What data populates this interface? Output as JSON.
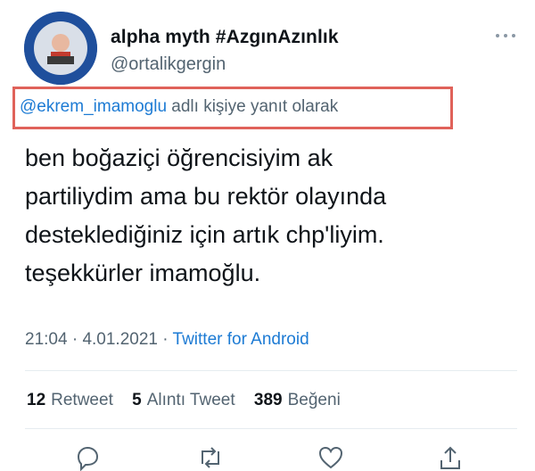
{
  "tweet": {
    "display_name": "alpha myth #AzgınAzınlık",
    "handle": "@ortalikgergin",
    "reply_mention": "@ekrem_imamoglu",
    "reply_suffix": " adlı kişiye yanıt olarak",
    "text_lines": [
      "ben boğaziçi öğrencisiyim ak",
      "partiliydim ama bu rektör olayında",
      "desteklediğiniz için artık chp'liyim.",
      "teşekkürler imamoğlu."
    ],
    "time": "21:04",
    "date": "4.01.2021",
    "separator": " · ",
    "source": "Twitter for Android",
    "stats": {
      "retweets_count": "12",
      "retweets_label": "Retweet",
      "quotes_count": "5",
      "quotes_label": "Alıntı Tweet",
      "likes_count": "389",
      "likes_label": "Beğeni"
    }
  },
  "icons": {
    "more": "more-horizontal-icon",
    "reply": "reply-icon",
    "retweet": "retweet-icon",
    "like": "heart-icon",
    "share": "share-icon"
  },
  "colors": {
    "text": "#0f1419",
    "secondary": "#536471",
    "link": "#1d7bd4",
    "highlight_box": "#e0625a",
    "divider": "#e6ecf0"
  }
}
